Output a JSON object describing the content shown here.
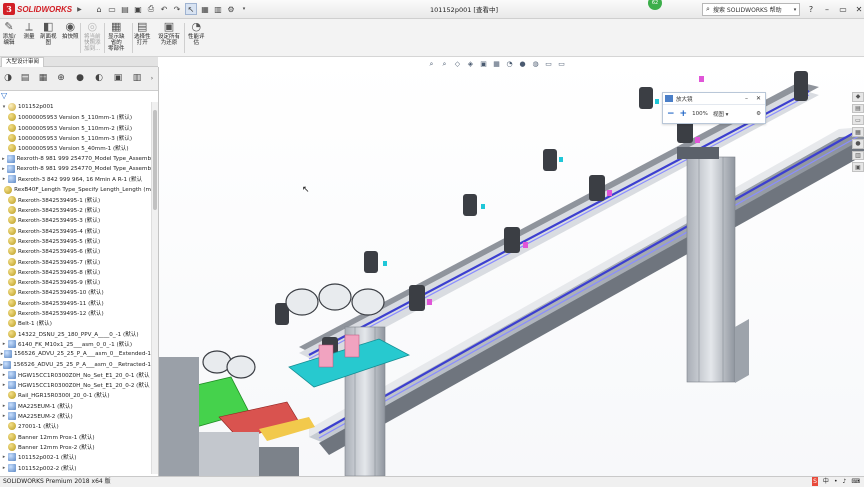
{
  "titlebar": {
    "brand": "SOLIDWORKS",
    "document_title": "101152p001 [查看中]",
    "search_placeholder": "搜索 SOLIDWORKS 帮助",
    "notify_count": "62"
  },
  "commands": [
    {
      "label": "添加/\n编辑",
      "icon": "add-edit-icon",
      "dim": false
    },
    {
      "label": "测量",
      "icon": "measure-icon",
      "dim": false
    },
    {
      "label": "剖面视\n图",
      "icon": "section-view-icon",
      "dim": false
    },
    {
      "label": "拍快照",
      "icon": "snapshot-icon",
      "dim": false
    },
    {
      "label": "将当前\n快照添\n加到...",
      "icon": "add-snapshot-icon",
      "dim": true
    },
    {
      "label": "显示缺\n省的\n零部件",
      "icon": "show-components-icon",
      "dim": false
    },
    {
      "label": "选择性\n打开",
      "icon": "selective-open-icon",
      "dim": false
    },
    {
      "label": "设定所有\n为还原",
      "icon": "set-resolved-icon",
      "dim": false
    },
    {
      "label": "性能评\n估",
      "icon": "performance-icon",
      "dim": false
    }
  ],
  "panel": {
    "tab_label": "大型设计审阅",
    "root": "101152p001",
    "items": [
      {
        "label": "10000005953 Version 5_110mm-1 (默认)",
        "type": "part",
        "expandable": false
      },
      {
        "label": "10000005953 Version 5_110mm-2 (默认)",
        "type": "part",
        "expandable": false
      },
      {
        "label": "10000005953 Version 5_110mm-3 (默认)",
        "type": "part",
        "expandable": false
      },
      {
        "label": "10000005953 Version 5_40mm-1 (默认)",
        "type": "part",
        "expandable": false
      },
      {
        "label": "Rexroth-8 981 999 254770_Model Type_Assemb",
        "type": "asm",
        "expandable": true
      },
      {
        "label": "Rexroth-8 981 999 254770_Model Type_Assemb",
        "type": "asm",
        "expandable": true
      },
      {
        "label": "Rexroth-3 842 999 964, 16 Mmin A R-1 (默认",
        "type": "asm",
        "expandable": true
      },
      {
        "label": "RexB40F_Length Type_Specify Length_Length (m",
        "type": "part",
        "expandable": false
      },
      {
        "label": "Rexroth-3842539495-1 (默认)",
        "type": "part",
        "expandable": false
      },
      {
        "label": "Rexroth-3842539495-2 (默认)",
        "type": "part",
        "expandable": false
      },
      {
        "label": "Rexroth-3842539495-3 (默认)",
        "type": "part",
        "expandable": false
      },
      {
        "label": "Rexroth-3842539495-4 (默认)",
        "type": "part",
        "expandable": false
      },
      {
        "label": "Rexroth-3842539495-5 (默认)",
        "type": "part",
        "expandable": false
      },
      {
        "label": "Rexroth-3842539495-6 (默认)",
        "type": "part",
        "expandable": false
      },
      {
        "label": "Rexroth-3842539495-7 (默认)",
        "type": "part",
        "expandable": false
      },
      {
        "label": "Rexroth-3842539495-8 (默认)",
        "type": "part",
        "expandable": false
      },
      {
        "label": "Rexroth-3842539495-9 (默认)",
        "type": "part",
        "expandable": false
      },
      {
        "label": "Rexroth-3842539495-10 (默认)",
        "type": "part",
        "expandable": false
      },
      {
        "label": "Rexroth-3842539495-11 (默认)",
        "type": "part",
        "expandable": false
      },
      {
        "label": "Rexroth-3842539495-12 (默认)",
        "type": "part",
        "expandable": false
      },
      {
        "label": "Belt-1 (默认)",
        "type": "part",
        "expandable": false
      },
      {
        "label": "14322_DSNU_25_180_PPV_A____0_-1 (默认)",
        "type": "part",
        "expandable": false
      },
      {
        "label": "6140_FK_M10x1_25___asm_0_0_-1 (默认)",
        "type": "asm",
        "expandable": true
      },
      {
        "label": "156526_ADVU_25_25_P_A___asm_0__Extended-1",
        "type": "asm",
        "expandable": true
      },
      {
        "label": "156526_ADVU_25_25_P_A___asm_0__Retracted-1",
        "type": "asm",
        "expandable": true
      },
      {
        "label": "HGW15CC1R0300Z0H_No_Set_E1_20_0-1 (默认",
        "type": "asm",
        "expandable": true
      },
      {
        "label": "HGW15CC1R0300Z0H_No_Set_E1_20_0-2 (默认",
        "type": "asm",
        "expandable": true
      },
      {
        "label": "Rail_HGR15R0300I_20_0-1 (默认)",
        "type": "part",
        "expandable": false
      },
      {
        "label": "MA225EUM-1 (默认)",
        "type": "asm",
        "expandable": true
      },
      {
        "label": "MA225EUM-2 (默认)",
        "type": "asm",
        "expandable": true
      },
      {
        "label": "27001-1 (默认)",
        "type": "part",
        "expandable": false
      },
      {
        "label": "Banner 12mm Prox-1 (默认)",
        "type": "part",
        "expandable": false
      },
      {
        "label": "Banner 12mm Prox-2 (默认)",
        "type": "part",
        "expandable": false
      },
      {
        "label": "101152p002-1 (默认)",
        "type": "asm",
        "expandable": true
      },
      {
        "label": "101152p002-2 (默认)",
        "type": "asm",
        "expandable": true
      }
    ]
  },
  "magnifier": {
    "title": "放大镜",
    "zoom": "100%",
    "view_label": "视图"
  },
  "status": {
    "text": "SOLIDWORKS Premium 2018 x64 版"
  }
}
